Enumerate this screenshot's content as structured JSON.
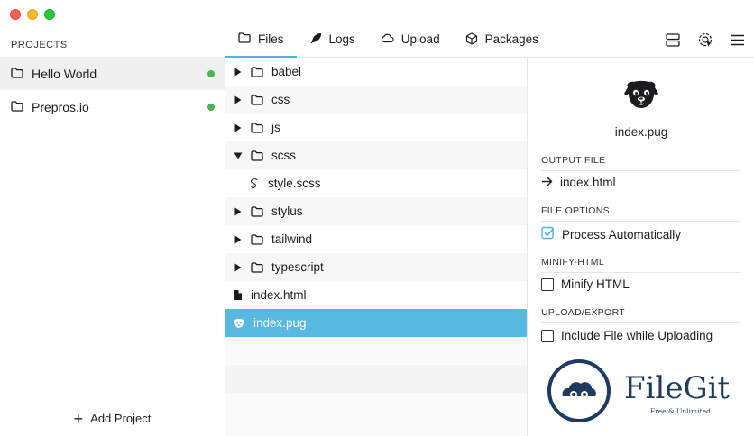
{
  "sidebar": {
    "section_title": "PROJECTS",
    "projects": [
      {
        "name": "Hello World",
        "status_color": "#4cb654",
        "active": true
      },
      {
        "name": "Prepros.io",
        "status_color": "#4cb654",
        "active": false
      }
    ],
    "add_project_label": "Add Project"
  },
  "toolbar": {
    "tabs": [
      {
        "label": "Files",
        "icon": "folder-icon",
        "active": true
      },
      {
        "label": "Logs",
        "icon": "feather-icon",
        "active": false
      },
      {
        "label": "Upload",
        "icon": "cloud-icon",
        "active": false
      },
      {
        "label": "Packages",
        "icon": "package-icon",
        "active": false
      }
    ],
    "icons": [
      "server-icon",
      "remote-inspect-icon",
      "menu-icon"
    ],
    "accent_color": "#4db6e2"
  },
  "tree": {
    "items": [
      {
        "name": "babel",
        "type": "folder",
        "expanded": false
      },
      {
        "name": "css",
        "type": "folder",
        "expanded": false
      },
      {
        "name": "js",
        "type": "folder",
        "expanded": false
      },
      {
        "name": "scss",
        "type": "folder",
        "expanded": true
      },
      {
        "name": "style.scss",
        "type": "sass-file",
        "child": true
      },
      {
        "name": "stylus",
        "type": "folder",
        "expanded": false
      },
      {
        "name": "tailwind",
        "type": "folder",
        "expanded": false
      },
      {
        "name": "typescript",
        "type": "folder",
        "expanded": false
      },
      {
        "name": "index.html",
        "type": "file"
      },
      {
        "name": "index.pug",
        "type": "pug-file",
        "selected": true
      }
    ],
    "selected_color": "#57b8e0"
  },
  "panel": {
    "filename": "index.pug",
    "output_file_title": "OUTPUT FILE",
    "output_file": "index.html",
    "file_options_title": "FILE OPTIONS",
    "process_automatically_label": "Process Automatically",
    "process_automatically_checked": true,
    "minify_title": "MINIFY-HTML",
    "minify_label": "Minify HTML",
    "minify_checked": false,
    "upload_title": "UPLOAD/EXPORT",
    "upload_label": "Include File while Uploading",
    "upload_checked": false
  },
  "watermark": {
    "brand": "FileGit",
    "tagline": "Free & Unlimited"
  }
}
